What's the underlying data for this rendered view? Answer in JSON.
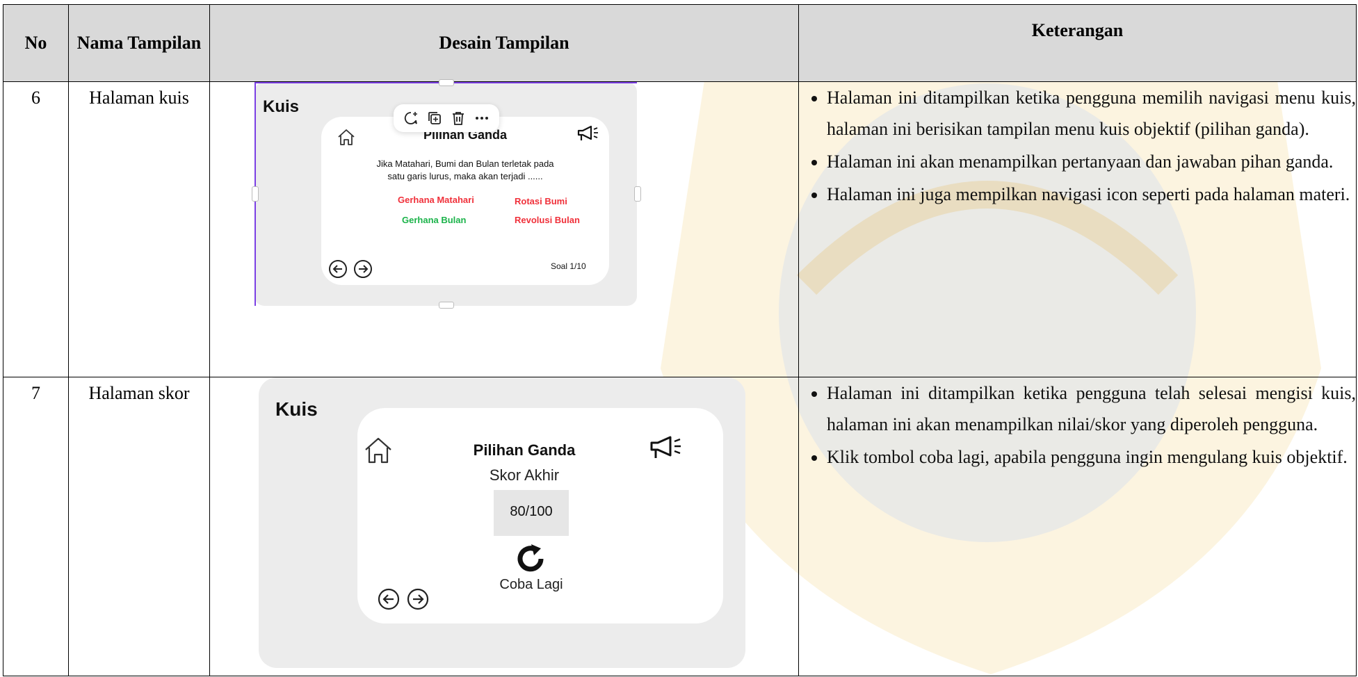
{
  "table": {
    "headers": {
      "no": "No",
      "nama": "Nama Tampilan",
      "desain": "Desain Tampilan",
      "keterangan": "Keterangan"
    },
    "rows": [
      {
        "no": "6",
        "nama": "Halaman kuis",
        "keterangan": [
          "Halaman ini ditampilkan ketika pengguna memilih navigasi menu kuis, halaman ini berisikan tampilan menu kuis objektif (pilihan ganda).",
          "Halaman ini akan menampilkan pertanyaan dan jawaban pihan ganda.",
          "Halaman ini juga mempilkan navigasi icon seperti pada halaman materi."
        ],
        "mock": {
          "title": "Kuis",
          "panel_title": "Pilihan Ganda",
          "question_line1": "Jika Matahari, Bumi dan Bulan terletak pada",
          "question_line2": "satu garis lurus, maka akan terjadi ......",
          "options": [
            "Gerhana Matahari",
            "Rotasi Bumi",
            "Gerhana Bulan",
            "Revolusi Bulan"
          ],
          "counter": "Soal 1/10",
          "colors": {
            "wrong": "#f0303a",
            "correct": "#1bb34a",
            "selection": "#7b3fe4"
          }
        }
      },
      {
        "no": "7",
        "nama": "Halaman skor",
        "keterangan": [
          "Halaman ini ditampilkan ketika pengguna telah selesai mengisi kuis, halaman ini akan menampilkan nilai/skor yang diperoleh pengguna.",
          "Klik tombol coba lagi, apabila pengguna ingin mengulang kuis objektif."
        ],
        "mock": {
          "title": "Kuis",
          "panel_title": "Pilihan Ganda",
          "score_label": "Skor Akhir",
          "score_value": "80/100",
          "retry_label": "Coba Lagi"
        }
      }
    ]
  }
}
